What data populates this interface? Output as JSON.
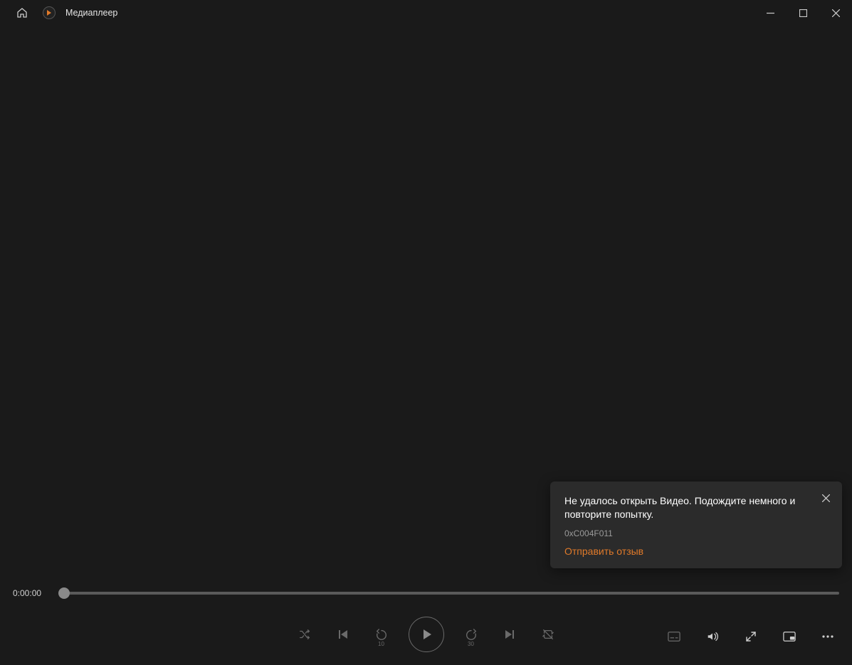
{
  "header": {
    "app_title": "Медиаплеер"
  },
  "playback": {
    "current_time": "0:00:00",
    "skip_back_label": "10",
    "skip_fwd_label": "30",
    "progress_percent": 0
  },
  "toast": {
    "message": "Не удалось открыть Видео. Подождите немного и повторите попытку.",
    "error_code": "0xC004F011",
    "feedback_link": "Отправить отзыв"
  },
  "icons": {
    "home": "home-icon",
    "minimize": "minimize-icon",
    "maximize": "maximize-icon",
    "close": "close-icon",
    "shuffle": "shuffle-icon",
    "previous": "previous-icon",
    "skip_back": "skip-back-icon",
    "play": "play-icon",
    "skip_fwd": "skip-forward-icon",
    "next": "next-icon",
    "repeat": "repeat-off-icon",
    "subtitles": "subtitles-icon",
    "volume": "volume-icon",
    "fullscreen": "fullscreen-icon",
    "mini": "mini-player-icon",
    "more": "more-icon"
  }
}
